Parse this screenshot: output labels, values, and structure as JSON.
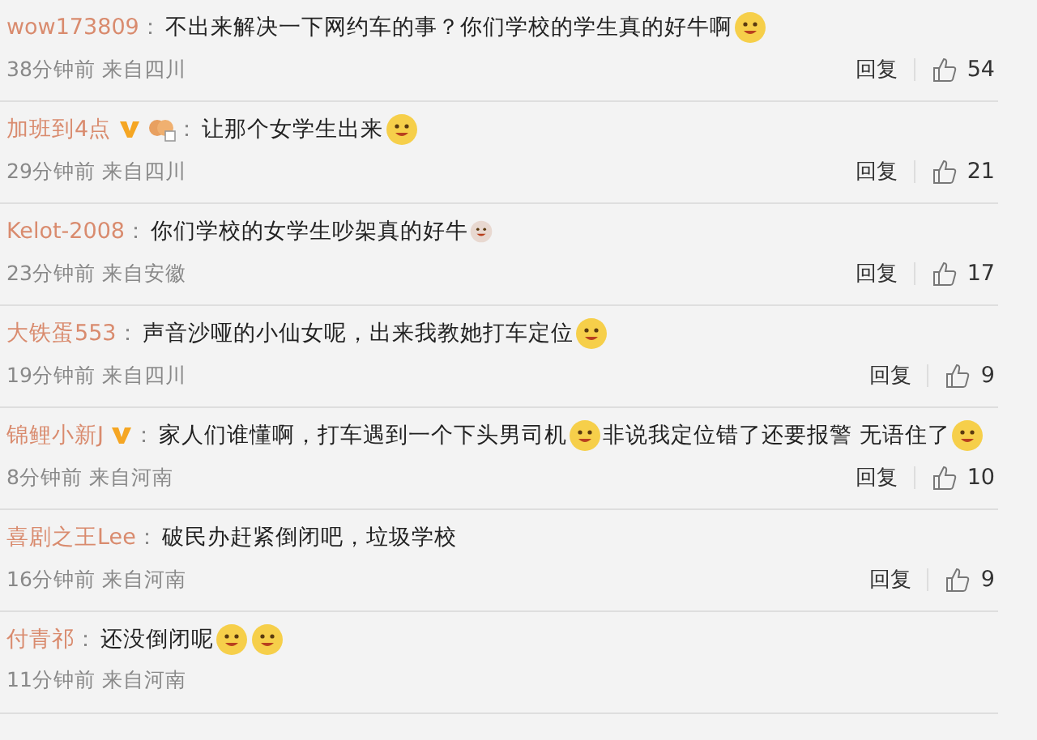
{
  "comments": [
    {
      "user": "wow173809",
      "colon": "：",
      "content": [
        {
          "kind": "text",
          "text": "不出来解决一下网约车的事？你们学校的学生真的好牛啊"
        },
        {
          "kind": "emoji"
        }
      ],
      "time": "38分钟前",
      "location": "来自四川",
      "reply": "回复",
      "likes": "54"
    },
    {
      "user": "加班到4点",
      "badges": [
        {
          "kind": "vip"
        },
        {
          "kind": "sticker"
        }
      ],
      "colon": "：",
      "content": [
        {
          "kind": "text",
          "text": "让那个女学生出来"
        },
        {
          "kind": "emoji"
        }
      ],
      "time": "29分钟前",
      "location": "来自四川",
      "reply": "回复",
      "likes": "21"
    },
    {
      "user": "Kelot-2008",
      "colon": "：",
      "content": [
        {
          "kind": "text",
          "text": "你们学校的女学生吵架真的好牛"
        },
        {
          "kind": "small-emoji"
        }
      ],
      "time": "23分钟前",
      "location": "来自安徽",
      "reply": "回复",
      "likes": "17"
    },
    {
      "user": "大铁蛋553",
      "colon": "：",
      "content": [
        {
          "kind": "text",
          "text": "声音沙哑的小仙女呢，出来我教她打车定位"
        },
        {
          "kind": "emoji"
        }
      ],
      "time": "19分钟前",
      "location": "来自四川",
      "reply": "回复",
      "likes": "9"
    },
    {
      "user": "锦鲤小新J",
      "badges": [
        {
          "kind": "vip"
        }
      ],
      "colon": "：",
      "content": [
        {
          "kind": "text",
          "text": "家人们谁懂啊，打车遇到一个下头男司机"
        },
        {
          "kind": "emoji"
        },
        {
          "kind": "text",
          "text": " 非说我定位错了还要报警 无语住了"
        },
        {
          "kind": "emoji"
        }
      ],
      "time": "8分钟前",
      "location": "来自河南",
      "reply": "回复",
      "likes": "10"
    },
    {
      "user": "喜剧之王Lee",
      "colon": "：",
      "content": [
        {
          "kind": "text",
          "text": "破民办赶紧倒闭吧，垃圾学校"
        }
      ],
      "time": "16分钟前",
      "location": "来自河南",
      "reply": "回复",
      "likes": "9"
    },
    {
      "user": "付青祁",
      "colon": "：",
      "content": [
        {
          "kind": "text",
          "text": "还没倒闭呢"
        },
        {
          "kind": "emoji"
        },
        {
          "kind": "emoji"
        }
      ],
      "time": "11分钟前",
      "location": "来自河南"
    }
  ]
}
